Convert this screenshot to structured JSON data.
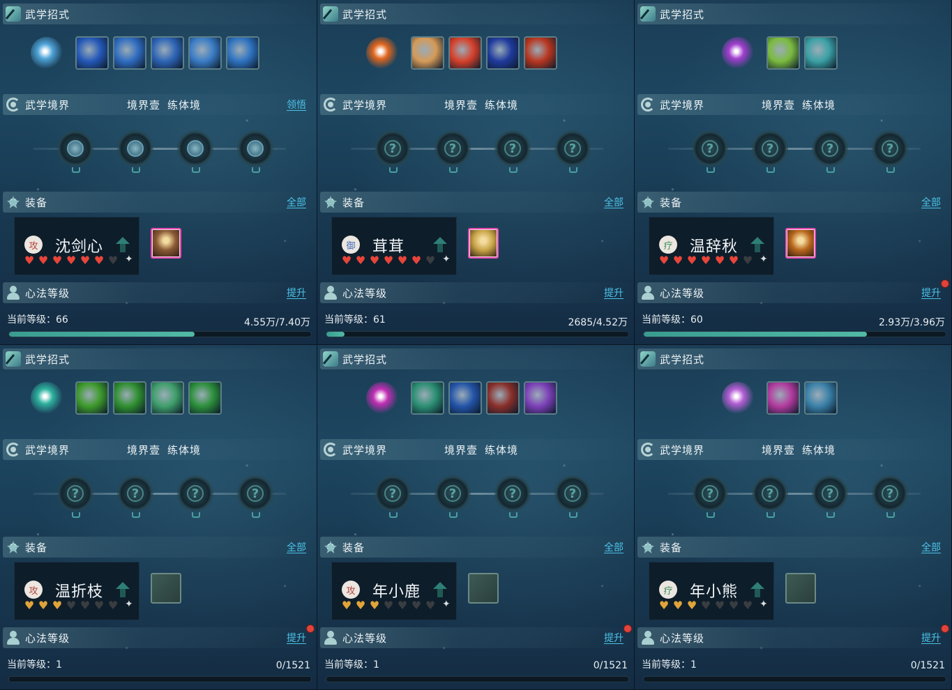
{
  "labels": {
    "skills_title": "武学招式",
    "realm_title": "武学境界",
    "equip_title": "装备",
    "equip_all": "全部",
    "mind_title": "心法等级",
    "mind_upgrade": "提升",
    "level_prefix": "当前等级：",
    "realm_link": "领悟",
    "realm_state_1": "境界壹",
    "realm_state_2": "练体境"
  },
  "colors": {
    "heart_red": "#e8453a",
    "heart_gold": "#e0a43a",
    "heart_empty": "#3a3d40",
    "accent_link": "#4cc3e8",
    "progress": "#4bb09f"
  },
  "panels": [
    {
      "name": "沈剑心",
      "role": "攻",
      "role_color": "#b2453c",
      "level": "66",
      "exp": "4.55万/7.40万",
      "progress": 0.615,
      "hearts": "red",
      "filled": 6,
      "realm_link": true,
      "red_dot": false,
      "gear": "full",
      "gear_color": "#8a5a35",
      "orb": "#4fa4d8",
      "skills": [
        "#2458b8",
        "#2f6cc0",
        "#2d64b6",
        "#3a7cc6",
        "#2e72c0"
      ],
      "realm_nodes": [
        "blade-icon",
        "spiral-icon",
        "sword-icon",
        "dagger-icon"
      ]
    },
    {
      "name": "茸茸",
      "role": "御",
      "role_color": "#3f6dbb",
      "level": "61",
      "exp": "2685/4.52万",
      "progress": 0.06,
      "hearts": "red",
      "filled": 6,
      "realm_link": false,
      "red_dot": false,
      "gear": "full",
      "gear_color": "#c9a548",
      "orb": "#e2661d",
      "skills": [
        "#d59a58",
        "#d6402a",
        "#1f3a9c",
        "#b8361f"
      ],
      "realm_nodes": [
        "question-icon",
        "question-icon",
        "question-icon",
        "question-icon"
      ]
    },
    {
      "name": "温辞秋",
      "role": "疗",
      "role_color": "#3c8f5a",
      "level": "60",
      "exp": "2.93万/3.96万",
      "progress": 0.74,
      "hearts": "red",
      "filled": 6,
      "realm_link": false,
      "red_dot": true,
      "gear": "full",
      "gear_color": "#b8661c",
      "orb": "#a33fd0",
      "skills": [
        "#7bbb3f",
        "#3aa0a5"
      ],
      "realm_nodes": [
        "question-icon",
        "question-icon",
        "question-icon",
        "question-icon"
      ]
    },
    {
      "name": "温折枝",
      "role": "攻",
      "role_color": "#b2453c",
      "level": "1",
      "exp": "0/1521",
      "progress": 0,
      "hearts": "gold",
      "filled": 3,
      "realm_link": false,
      "red_dot": true,
      "gear": "empty",
      "orb": "#2fb3a0",
      "skills": [
        "#3d9a2a",
        "#2f8f2f",
        "#3e9e6a",
        "#2b8f3a"
      ],
      "realm_nodes": [
        "question-icon",
        "question-icon",
        "question-icon",
        "question-icon"
      ]
    },
    {
      "name": "年小鹿",
      "role": "攻",
      "role_color": "#b2453c",
      "level": "1",
      "exp": "0/1521",
      "progress": 0,
      "hearts": "gold",
      "filled": 3,
      "realm_link": false,
      "red_dot": true,
      "gear": "empty",
      "orb": "#c12fb4",
      "skills": [
        "#2b8f73",
        "#2354a8",
        "#8a2f2a",
        "#7c3fb8"
      ],
      "realm_nodes": [
        "question-icon",
        "question-icon",
        "question-icon",
        "question-icon"
      ]
    },
    {
      "name": "年小熊",
      "role": "疗",
      "role_color": "#3c8f5a",
      "level": "1",
      "exp": "0/1521",
      "progress": 0,
      "hearts": "gold",
      "filled": 3,
      "realm_link": false,
      "red_dot": true,
      "gear": "empty",
      "orb": "#b65fd6",
      "skills": [
        "#b23a9e",
        "#3a80a8"
      ],
      "realm_nodes": [
        "question-icon",
        "question-icon",
        "question-icon",
        "question-icon"
      ]
    }
  ]
}
